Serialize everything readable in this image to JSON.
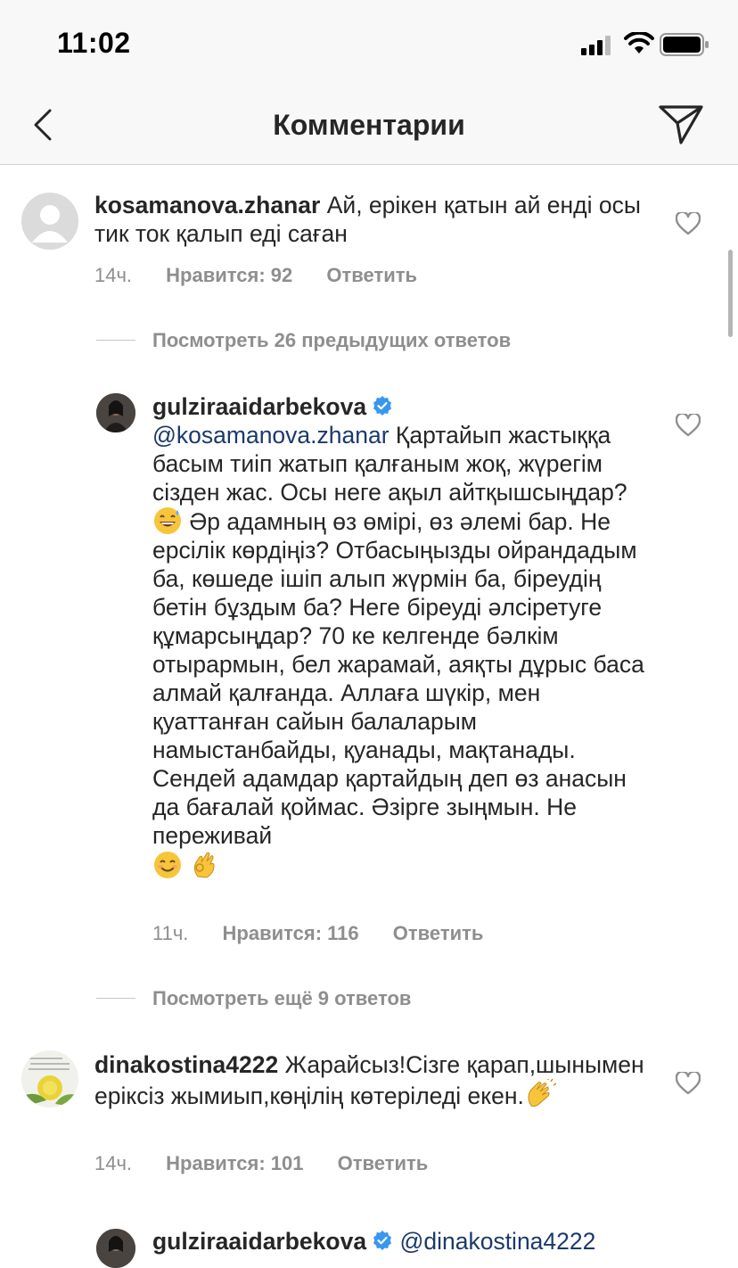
{
  "status_bar": {
    "time": "11:02"
  },
  "header": {
    "title": "Комментарии"
  },
  "comments": [
    {
      "username": "kosamanova.zhanar",
      "text": "Ай, ерікен қатын ай енді осы тик ток қалып еді саған",
      "time": "14ч.",
      "likes": "Нравится: 92",
      "reply": "Ответить"
    },
    {
      "username": "dinakostina4222",
      "text": "Жарайсыз!Сізге қарап,шынымен еріксіз  жымиып,көңілің көтеріледі екен.",
      "time": "14ч.",
      "likes": "Нравится: 101",
      "reply": "Ответить"
    }
  ],
  "view_previous": "Посмотреть 26 предыдущих ответов",
  "reply1": {
    "username": "gulziraaidarbekova",
    "mention": "@kosamanova.zhanar",
    "text_a": "  Қартайып жастыққа басым тиіп жатып қалғаным жоқ, жүрегім сізден жас. Осы неге ақыл айтқышсыңдар?",
    "text_b": " Әр адамның өз өмірі, өз әлемі бар. Не ерсілік көрдіңіз? Отбасыңызды ойрандадым ба, көшеде ішіп алып жүрмін ба, біреудің бетін бұздым ба? Неге біреуді әлсіретуге құмарсыңдар? 70 ке келгенде бәлкім отырармын, бел жарамай, аяқты дұрыс баса алмай қалғанда. Аллаға шүкір, мен қуаттанған сайын балаларым намыстанбайды, қуанады, мақтанады. Сендей адамдар қартайдың деп өз анасын да бағалай қоймас. Әзірге зыңмын. Не переживай",
    "time": "11ч.",
    "likes": "Нравится: 116",
    "reply": "Ответить"
  },
  "view_more": "Посмотреть ещё 9 ответов",
  "reply2": {
    "username": "gulziraaidarbekova",
    "mention": "@dinakostina4222"
  },
  "icons": {
    "back": "chevron-left-icon",
    "send": "paper-plane-icon",
    "heart": "heart-outline-icon",
    "verified": "verified-badge-icon"
  },
  "colors": {
    "mention": "#1b3a6b",
    "meta": "#8e8e8e",
    "verified": "#3897f0"
  }
}
